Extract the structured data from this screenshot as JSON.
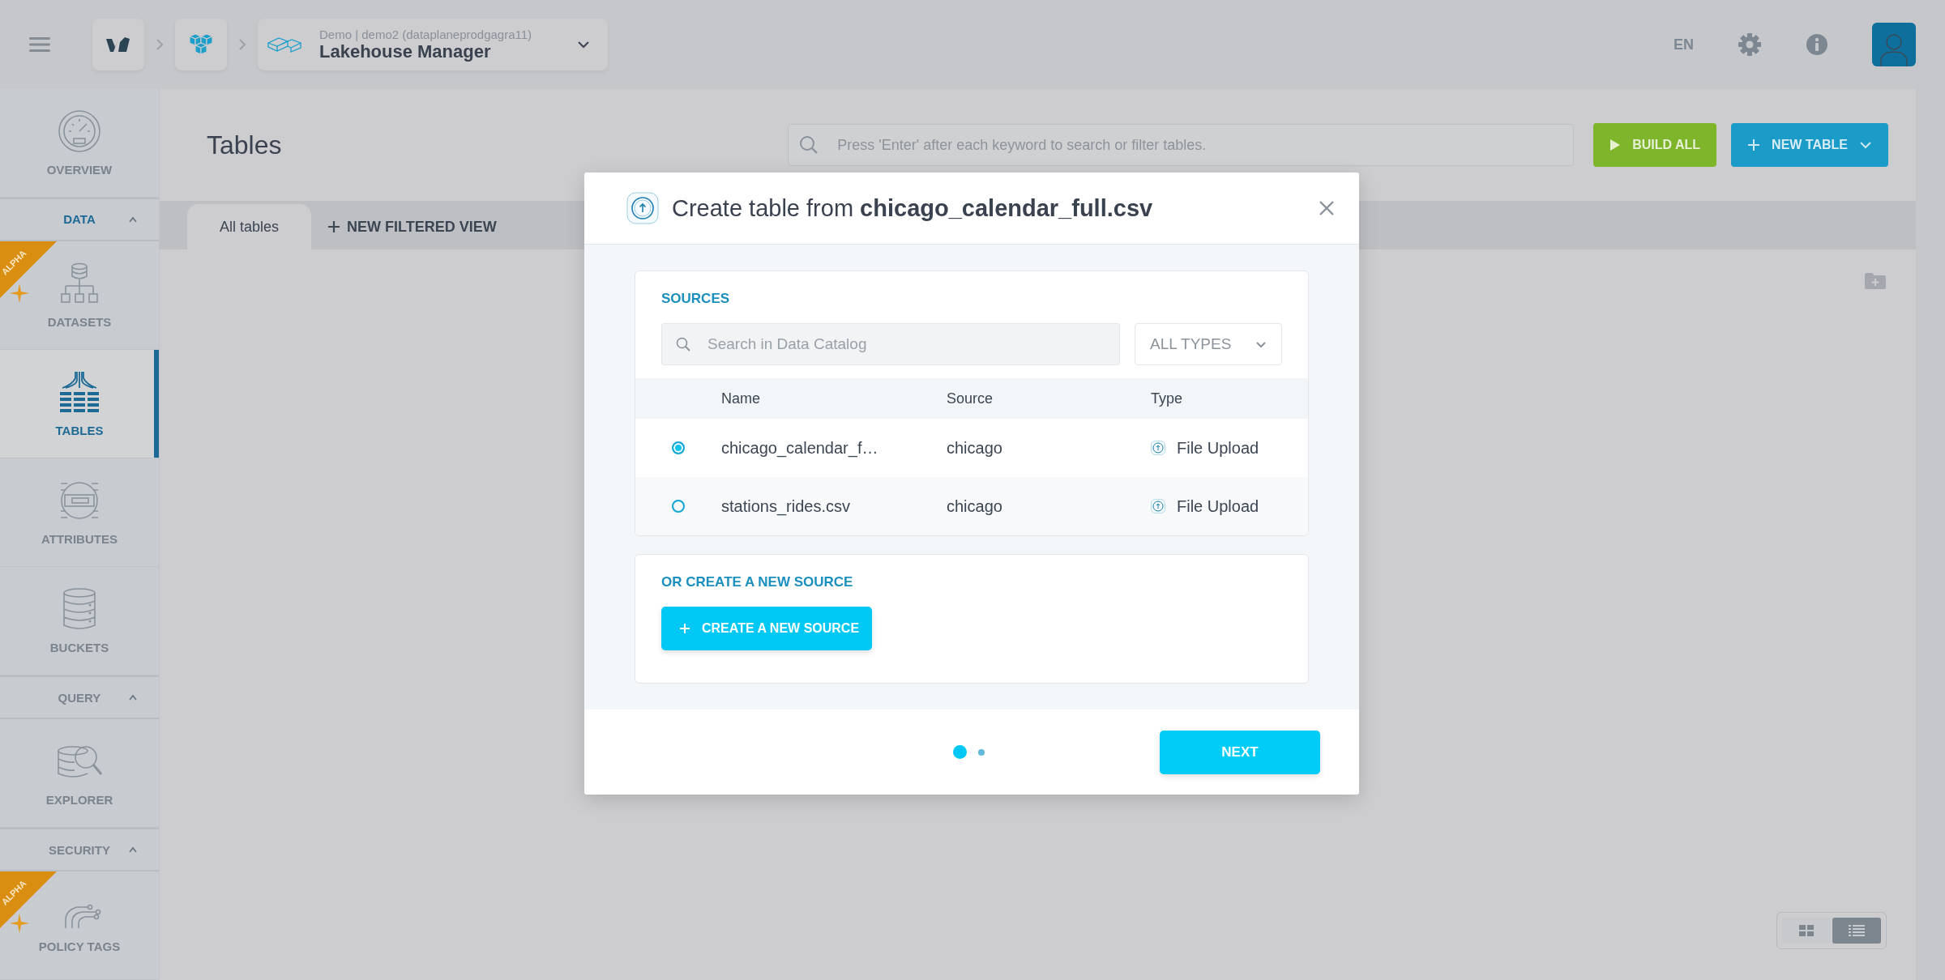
{
  "topbar": {
    "breadcrumb": {
      "subtitle": "Demo | demo2 (dataplaneprodgagra11)",
      "title": "Lakehouse Manager"
    },
    "language": "EN"
  },
  "sidebar": {
    "items": [
      {
        "kind": "nav",
        "label": "OVERVIEW",
        "selected": false
      },
      {
        "kind": "section",
        "label": "DATA",
        "expanded": true
      },
      {
        "kind": "nav",
        "label": "DATASETS",
        "selected": false,
        "badge": "ALPHA"
      },
      {
        "kind": "nav",
        "label": "TABLES",
        "selected": true
      },
      {
        "kind": "nav",
        "label": "ATTRIBUTES",
        "selected": false
      },
      {
        "kind": "nav",
        "label": "BUCKETS",
        "selected": false
      },
      {
        "kind": "section",
        "label": "QUERY",
        "expanded": true
      },
      {
        "kind": "nav",
        "label": "EXPLORER",
        "selected": false
      },
      {
        "kind": "section",
        "label": "SECURITY",
        "expanded": true
      },
      {
        "kind": "nav",
        "label": "POLICY TAGS",
        "selected": false,
        "badge": "ALPHA"
      }
    ]
  },
  "page": {
    "title": "Tables",
    "search": {
      "placeholder": "Press 'Enter' after each keyword to search or filter tables."
    },
    "build_all": "BUILD ALL",
    "new_table": "NEW TABLE",
    "tabs": [
      {
        "label": "All tables",
        "selected": true
      }
    ],
    "new_filtered_view": "NEW FILTERED VIEW",
    "view_toggle": [
      {
        "selected": false
      },
      {
        "selected": true
      }
    ]
  },
  "modal": {
    "title": "Create table from **chicago_calendar_full.csv**",
    "sources": {
      "heading": "SOURCES",
      "search": {
        "placeholder": "Search in Data Catalog"
      },
      "type_filter": "ALL TYPES",
      "columns": [
        "Name",
        "Source",
        "Type"
      ],
      "rows": [
        {
          "selected": true,
          "name": "chicago_calendar_f…",
          "source": "chicago",
          "type": "File Upload"
        },
        {
          "selected": false,
          "name": "stations_rides.csv",
          "source": "chicago",
          "type": "File Upload"
        }
      ]
    },
    "create": {
      "heading": "OR CREATE A NEW SOURCE",
      "button": "CREATE A NEW SOURCE"
    },
    "steps": [
      {
        "selected": true
      },
      {
        "selected": false
      }
    ],
    "next": "NEXT"
  }
}
